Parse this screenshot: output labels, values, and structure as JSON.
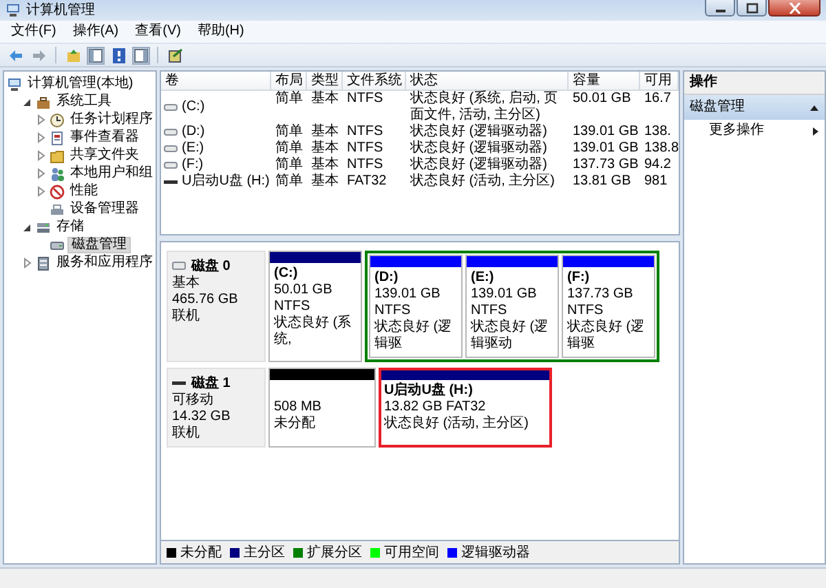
{
  "window": {
    "title": "计算机管理"
  },
  "menu": [
    {
      "label": "文件(F)"
    },
    {
      "label": "操作(A)"
    },
    {
      "label": "查看(V)"
    },
    {
      "label": "帮助(H)"
    }
  ],
  "tree": [
    {
      "label": "计算机管理(本地)",
      "selected": false,
      "children": [
        {
          "label": "系统工具",
          "expanded": true,
          "selected": false,
          "children": [
            {
              "label": "任务计划程序",
              "expanded": false,
              "selected": false
            },
            {
              "label": "事件查看器",
              "expanded": false,
              "selected": false
            },
            {
              "label": "共享文件夹",
              "expanded": false,
              "selected": false
            },
            {
              "label": "本地用户和组",
              "expanded": false,
              "selected": false
            },
            {
              "label": "性能",
              "expanded": false,
              "selected": false
            },
            {
              "label": "设备管理器",
              "selected": false
            }
          ]
        },
        {
          "label": "存储",
          "expanded": true,
          "selected": false,
          "children": [
            {
              "label": "磁盘管理",
              "selected": true
            }
          ]
        },
        {
          "label": "服务和应用程序",
          "expanded": false,
          "selected": false
        }
      ]
    }
  ],
  "volumes": {
    "columns": [
      "卷",
      "布局",
      "类型",
      "文件系统",
      "状态",
      "容量",
      "可用"
    ],
    "rows": [
      {
        "kind": "fixed",
        "cells": [
          "(C:)",
          "简单",
          "基本",
          "NTFS",
          "状态良好 (系统, 启动, 页面文件, 活动, 主分区)",
          "50.01 GB",
          "16.7"
        ]
      },
      {
        "kind": "fixed",
        "cells": [
          "(D:)",
          "简单",
          "基本",
          "NTFS",
          "状态良好 (逻辑驱动器)",
          "139.01 GB",
          "138."
        ]
      },
      {
        "kind": "fixed",
        "cells": [
          "(E:)",
          "简单",
          "基本",
          "NTFS",
          "状态良好 (逻辑驱动器)",
          "139.01 GB",
          "138.8"
        ]
      },
      {
        "kind": "fixed",
        "cells": [
          "(F:)",
          "简单",
          "基本",
          "NTFS",
          "状态良好 (逻辑驱动器)",
          "137.73 GB",
          "94.2"
        ]
      },
      {
        "kind": "removable",
        "cells": [
          "U启动U盘 (H:)",
          "简单",
          "基本",
          "FAT32",
          "状态良好 (活动, 主分区)",
          "13.81 GB",
          "981"
        ]
      }
    ]
  },
  "disks": [
    {
      "kind": "fixed",
      "name": "磁盘 0",
      "type": "基本",
      "size": "465.76 GB",
      "status": "联机",
      "partitions": [
        {
          "kind": "primary",
          "name": "(C:)",
          "size": "50.01 GB NTFS",
          "status": "状态良好 (系统,",
          "highlighted": false
        },
        {
          "kind": "extended",
          "children": [
            {
              "kind": "logical",
              "name": "(D:)",
              "size": "139.01 GB NTFS",
              "status": "状态良好 (逻辑驱",
              "highlighted": false
            },
            {
              "kind": "logical",
              "name": "(E:)",
              "size": "139.01 GB NTFS",
              "status": "状态良好 (逻辑驱动",
              "highlighted": false
            },
            {
              "kind": "logical",
              "name": "(F:)",
              "size": "137.73 GB NTFS",
              "status": "状态良好 (逻辑驱",
              "highlighted": false
            }
          ]
        }
      ]
    },
    {
      "kind": "removable",
      "name": "磁盘 1",
      "type": "可移动",
      "size": "14.32 GB",
      "status": "联机",
      "partitions": [
        {
          "kind": "unallocated",
          "size": "508 MB",
          "status": "未分配",
          "highlighted": false
        },
        {
          "kind": "primary",
          "name": "U启动U盘  (H:)",
          "size": "13.82 GB FAT32",
          "status": "状态良好 (活动, 主分区)",
          "highlighted": true
        }
      ]
    }
  ],
  "legend": [
    {
      "kind": "unallocated",
      "label": "未分配",
      "color": "#000000"
    },
    {
      "kind": "primary",
      "label": "主分区",
      "color": "#000080"
    },
    {
      "kind": "extended",
      "label": "扩展分区",
      "color": "#008000"
    },
    {
      "kind": "free",
      "label": "可用空间",
      "color": "#00ff00"
    },
    {
      "kind": "logical",
      "label": "逻辑驱动器",
      "color": "#0000ff"
    }
  ],
  "actions": {
    "title": "操作",
    "sections": [
      {
        "label": "磁盘管理",
        "expanded": true,
        "items": [
          {
            "label": "更多操作"
          }
        ]
      }
    ]
  }
}
